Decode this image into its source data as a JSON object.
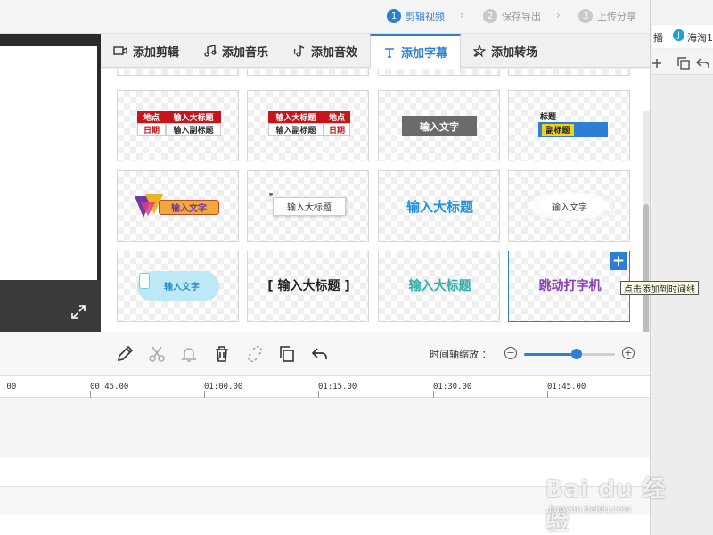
{
  "steps": [
    {
      "num": "1",
      "label": "剪辑视频"
    },
    {
      "num": "2",
      "label": "保存导出"
    },
    {
      "num": "3",
      "label": "上传分享"
    }
  ],
  "tabs": [
    {
      "label": "添加剪辑",
      "icon": "video-icon"
    },
    {
      "label": "添加音乐",
      "icon": "music-icon"
    },
    {
      "label": "添加音效",
      "icon": "sound-effect-icon"
    },
    {
      "label": "添加字幕",
      "icon": "text-icon",
      "active": true
    },
    {
      "label": "添加转场",
      "icon": "transition-icon"
    }
  ],
  "templates": {
    "t1": {
      "place": "地点",
      "date": "日期",
      "title": "输入大标题",
      "subtitle": "输入副标题"
    },
    "t2": {
      "title": "输入大标题",
      "subtitle": "输入副标题",
      "place": "地点",
      "date": "日期"
    },
    "t3": {
      "text": "输入文字"
    },
    "t4": {
      "title": "标题",
      "subtitle": "副标题"
    },
    "t5": {
      "text": "输入文字"
    },
    "t6": {
      "text": "输入大标题"
    },
    "t7": {
      "text": "输入大标题"
    },
    "t8": {
      "text": "输入文字"
    },
    "t9": {
      "text": "输入文字"
    },
    "t10": {
      "text": "[ 输入大标题 ]"
    },
    "t11": {
      "text": "输入大标题"
    },
    "t12": {
      "text": "跳动打字机"
    }
  },
  "add_button": "+",
  "tooltip": "点击添加到时间线",
  "zoom": {
    "label": "时间轴缩放 ：",
    "minus": "−",
    "plus": "+",
    "level": 0.58
  },
  "ruler": [
    ".00",
    "00:45.00",
    "01:00.00",
    "01:15.00",
    "01:30.00",
    "01:45.00"
  ],
  "right_panel": {
    "text1": "播",
    "text2": "海淘1"
  },
  "watermark": {
    "main": "Bai du 经验",
    "sub": "jingyan.baidu.com"
  },
  "colors": {
    "accent": "#2d7fd6",
    "red": "#c8151c"
  }
}
